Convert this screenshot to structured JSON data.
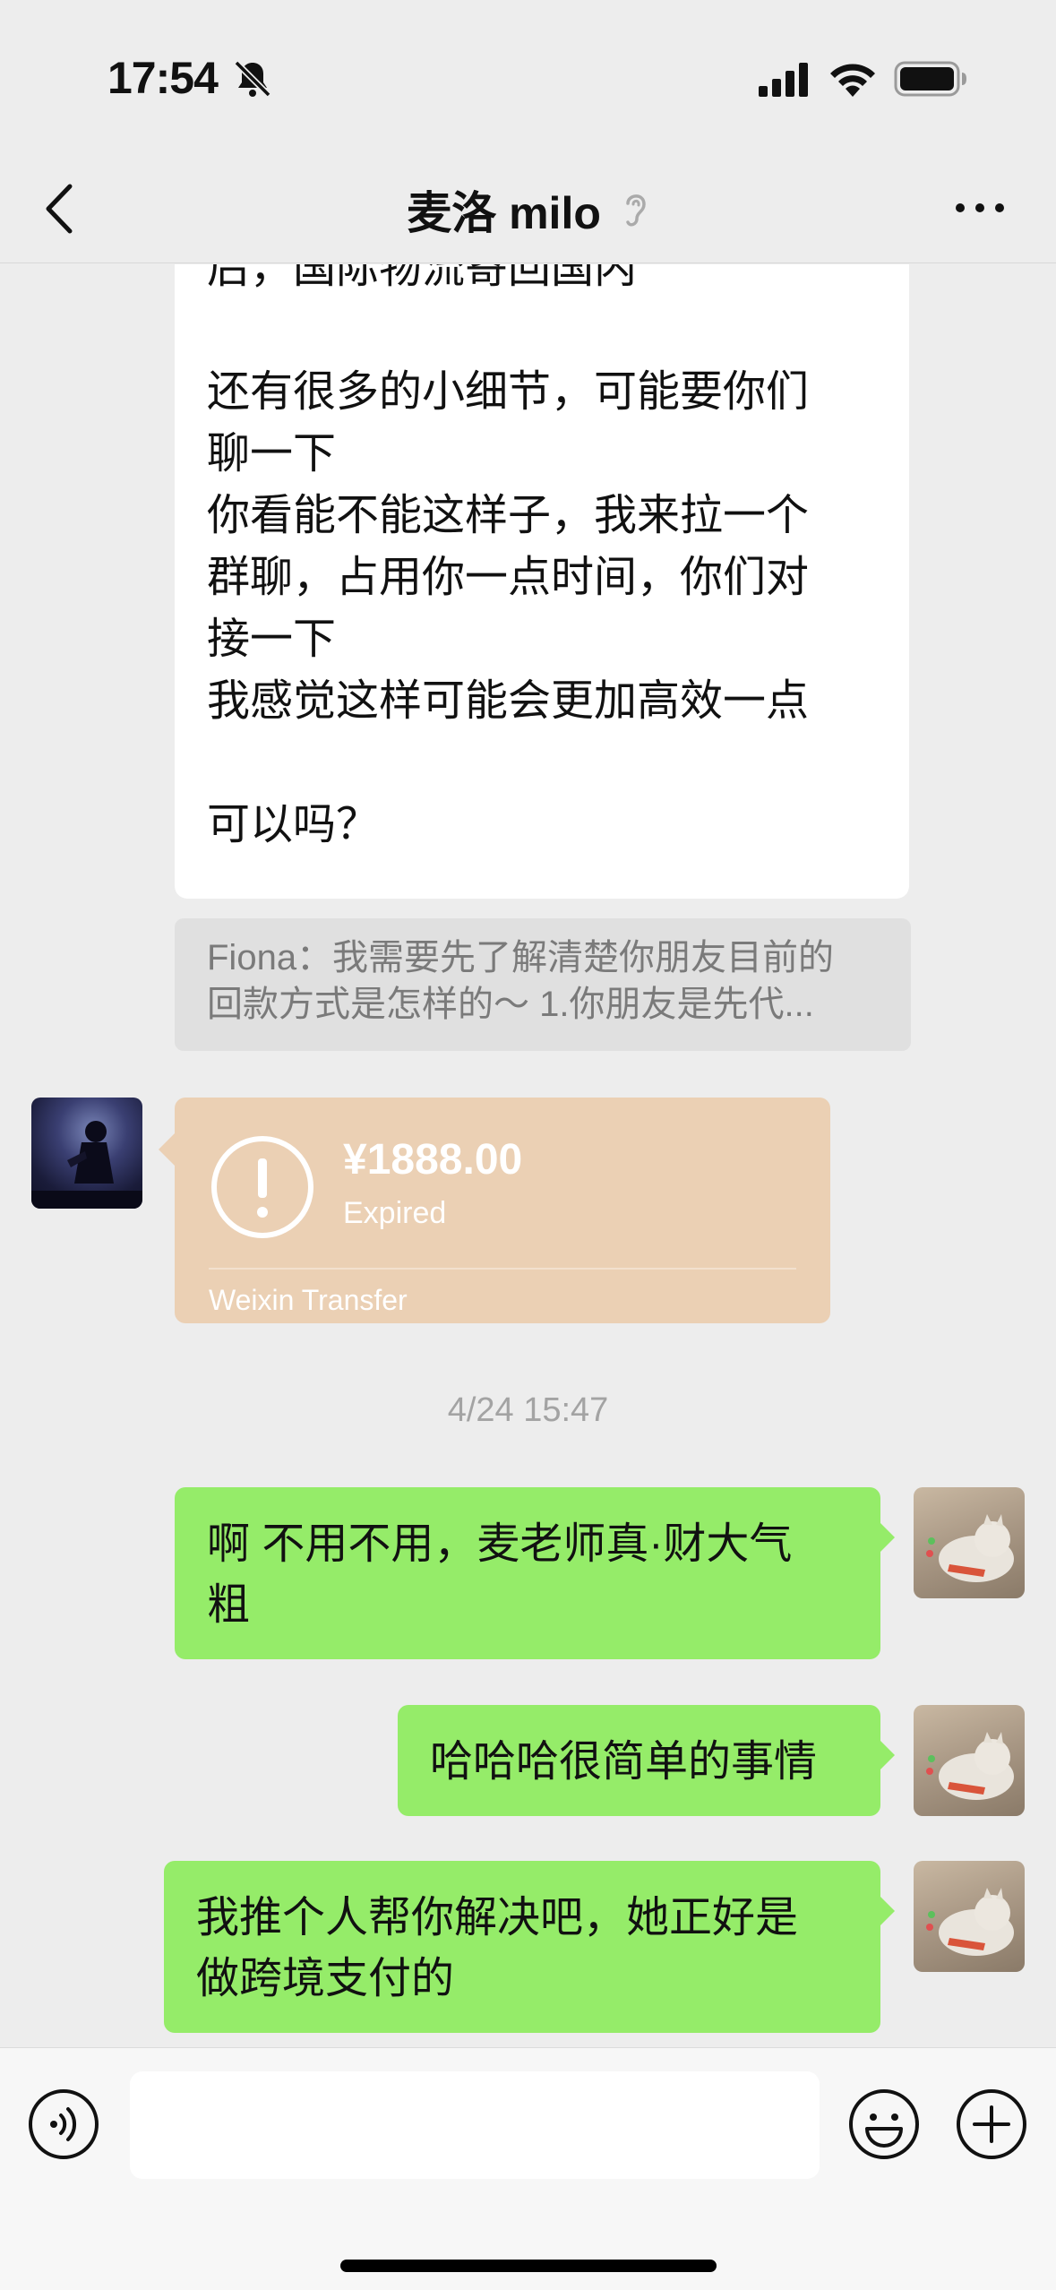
{
  "status_bar": {
    "time": "17:54",
    "icons": [
      "bell-slash-icon",
      "cellular-signal-icon",
      "wifi-icon",
      "battery-icon"
    ]
  },
  "nav": {
    "title": "麦洛 milo",
    "icons": [
      "back-chevron-icon",
      "ear-icon",
      "more-icon"
    ]
  },
  "messages": {
    "incoming_long": {
      "lines": [
        "后，国际物流寄回国内",
        "",
        "还有很多的小细节，可能要你们",
        "聊一下",
        "你看能不能这样子，我来拉一个",
        "群聊，占用你一点时间，你们对",
        "接一下",
        "我感觉这样可能会更加高效一点",
        "",
        "可以吗？"
      ]
    },
    "quote": {
      "line1": "Fiona：我需要先了解清楚你朋友目前的",
      "line2": "回款方式是怎样的～ 1.你朋友是先代..."
    },
    "transfer": {
      "amount": "¥1888.00",
      "status": "Expired",
      "footer": "Weixin Transfer",
      "icon": "exclamation-circle-icon",
      "color": "#ebd0b4"
    },
    "timestamp": "4/24 15:47",
    "outgoing": [
      {
        "lines": [
          "啊 不用不用，麦老师真·财大气",
          "粗"
        ]
      },
      {
        "lines": [
          "哈哈哈很简单的事情"
        ]
      },
      {
        "lines": [
          "我推个人帮你解决吧，她正好是",
          "做跨境支付的"
        ]
      }
    ]
  },
  "input_bar": {
    "placeholder": "",
    "icons": [
      "voice-icon",
      "emoji-icon",
      "plus-icon"
    ]
  },
  "colors": {
    "background": "#ededed",
    "outgoing_bubble": "#95ec69",
    "incoming_bubble": "#ffffff"
  }
}
